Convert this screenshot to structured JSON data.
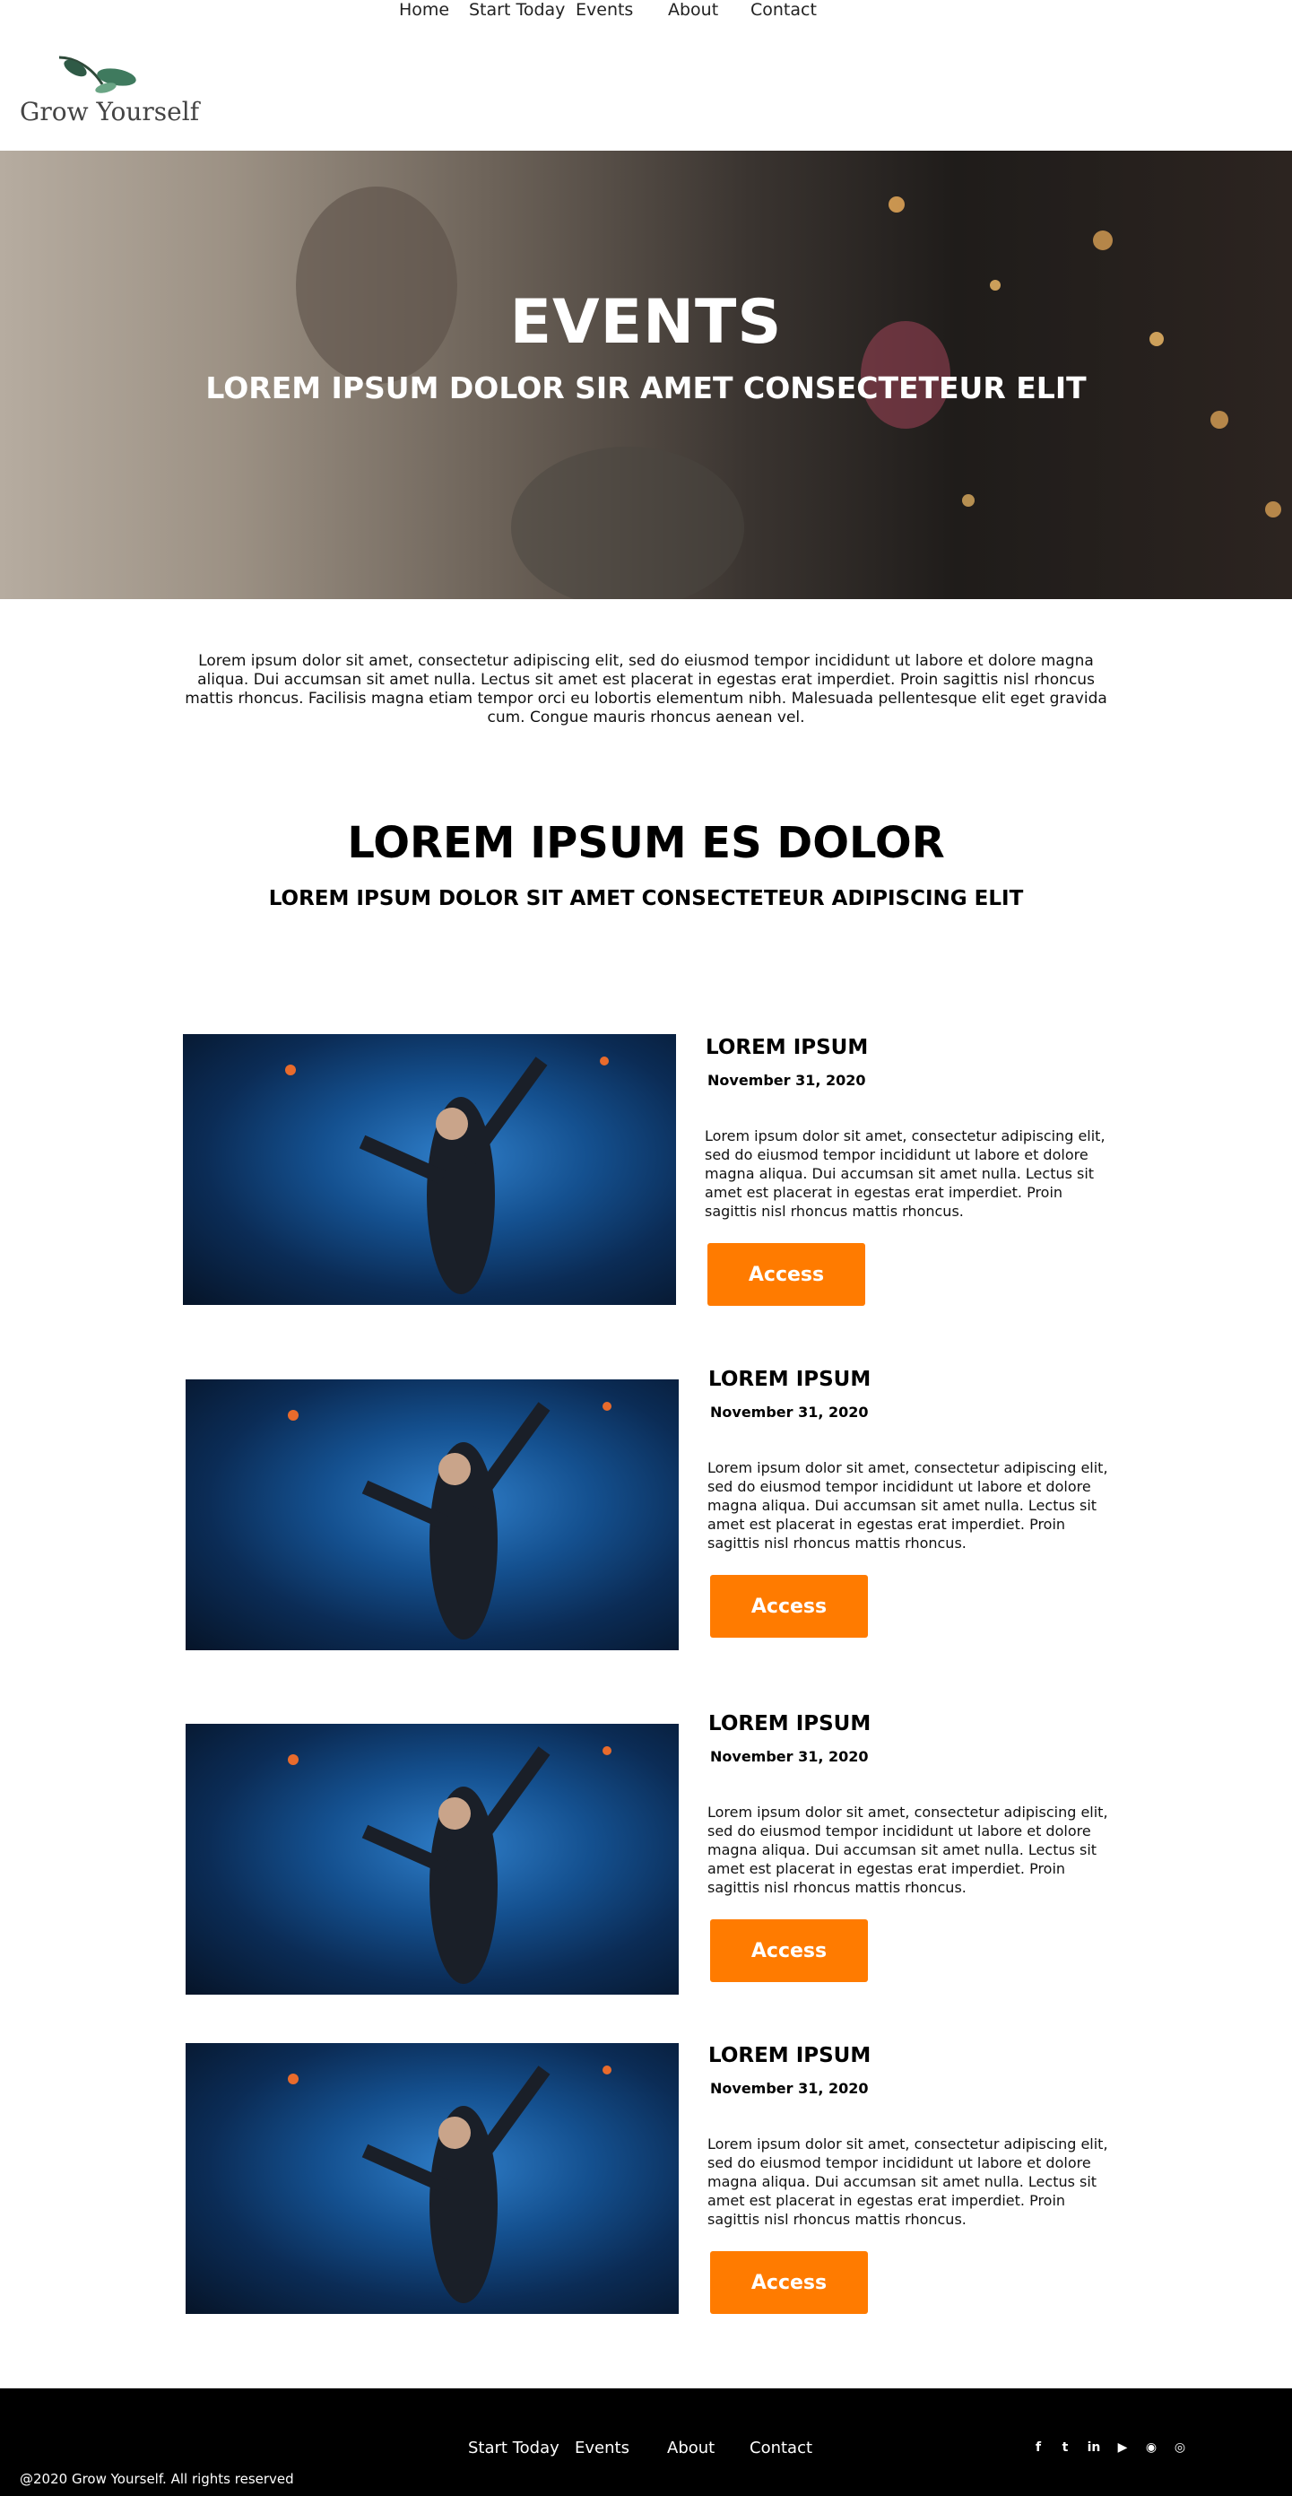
{
  "brand": {
    "name": "Grow Yourself"
  },
  "nav": {
    "items": [
      {
        "label": "Home"
      },
      {
        "label": "Start Today"
      },
      {
        "label": "Events"
      },
      {
        "label": "About"
      },
      {
        "label": "Contact"
      }
    ]
  },
  "hero": {
    "title": "EVENTS",
    "subtitle": "LOREM IPSUM DOLOR SIR AMET CONSECTETEUR ELIT"
  },
  "intro": {
    "text": "Lorem ipsum dolor sit amet, consectetur adipiscing elit, sed do eiusmod tempor incididunt ut labore et dolore magna aliqua. Dui accumsan sit amet nulla. Lectus sit amet est placerat in egestas erat imperdiet. Proin sagittis nisl rhoncus mattis rhoncus. Facilisis magna etiam tempor orci eu lobortis elementum nibh. Malesuada pellentesque elit eget gravida cum. Congue mauris rhoncus aenean vel."
  },
  "section": {
    "title": "LOREM IPSUM ES DOLOR",
    "subtitle": "LOREM IPSUM DOLOR SIT AMET CONSECTETEUR ADIPISCING ELIT"
  },
  "events": [
    {
      "title": "LOREM IPSUM",
      "date": "November 31, 2020",
      "description": "Lorem ipsum dolor sit amet, consectetur adipiscing elit, sed do eiusmod tempor incididunt ut labore et dolore magna aliqua. Dui accumsan sit amet nulla. Lectus sit amet est placerat in egestas erat imperdiet. Proin sagittis nisl rhoncus mattis rhoncus.",
      "button": "Access"
    },
    {
      "title": "LOREM IPSUM",
      "date": "November 31, 2020",
      "description": "Lorem ipsum dolor sit amet, consectetur adipiscing elit, sed do eiusmod tempor incididunt ut labore et dolore magna aliqua. Dui accumsan sit amet nulla. Lectus sit amet est placerat in egestas erat imperdiet. Proin sagittis nisl rhoncus mattis rhoncus.",
      "button": "Access"
    },
    {
      "title": "LOREM IPSUM",
      "date": "November 31, 2020",
      "description": "Lorem ipsum dolor sit amet, consectetur adipiscing elit, sed do eiusmod tempor incididunt ut labore et dolore magna aliqua. Dui accumsan sit amet nulla. Lectus sit amet est placerat in egestas erat imperdiet. Proin sagittis nisl rhoncus mattis rhoncus.",
      "button": "Access"
    },
    {
      "title": "LOREM IPSUM",
      "date": "November 31, 2020",
      "description": "Lorem ipsum dolor sit amet, consectetur adipiscing elit, sed do eiusmod tempor incididunt ut labore et dolore magna aliqua. Dui accumsan sit amet nulla. Lectus sit amet est placerat in egestas erat imperdiet. Proin sagittis nisl rhoncus mattis rhoncus.",
      "button": "Access"
    }
  ],
  "footer": {
    "nav": [
      {
        "label": "Start Today"
      },
      {
        "label": "Events"
      },
      {
        "label": "About"
      },
      {
        "label": "Contact"
      }
    ],
    "copyright": "@2020 Grow Yourself. All rights reserved",
    "social": [
      {
        "icon": "facebook-icon",
        "glyph": "f"
      },
      {
        "icon": "twitter-icon",
        "glyph": "t"
      },
      {
        "icon": "linkedin-icon",
        "glyph": "in"
      },
      {
        "icon": "youtube-icon",
        "glyph": "▶"
      },
      {
        "icon": "podcast-icon",
        "glyph": "◉"
      },
      {
        "icon": "instagram-icon",
        "glyph": "◎"
      }
    ]
  },
  "colors": {
    "accent": "#ff7b00",
    "footer_bg": "#000000"
  }
}
